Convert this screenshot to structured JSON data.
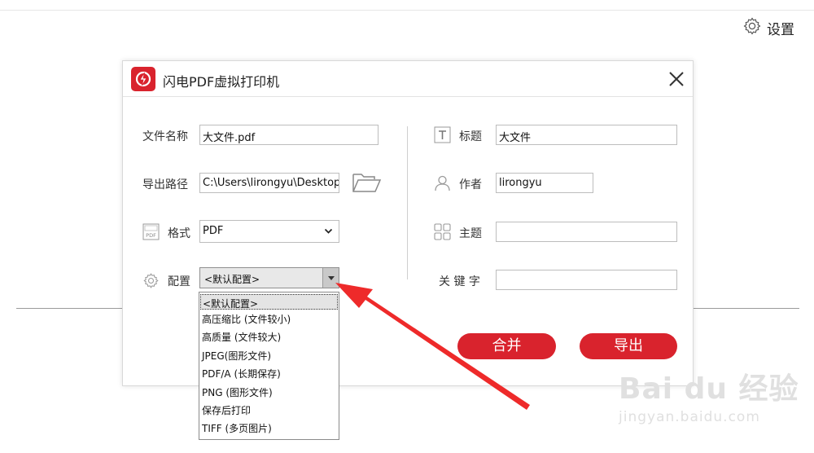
{
  "header": {
    "settings_label": "设置"
  },
  "dialog": {
    "title": "闪电PDF虚拟打印机",
    "left": {
      "filename": {
        "label": "文件名称",
        "value": "大文件.pdf"
      },
      "export_path": {
        "label": "导出路径",
        "value": "C:\\Users\\lirongyu\\Desktop"
      },
      "format": {
        "label": "格式",
        "value": "PDF"
      },
      "config": {
        "label": "配置",
        "value": "<默认配置>"
      }
    },
    "right": {
      "title_field": {
        "label": "标题",
        "value": "大文件"
      },
      "author_field": {
        "label": "作者",
        "value": "lirongyu"
      },
      "subject_field": {
        "label": "主题",
        "value": ""
      },
      "keyword_field": {
        "label": "关 键 字",
        "value": ""
      }
    },
    "buttons": {
      "merge": "合并",
      "export": "导出"
    }
  },
  "config_dropdown": {
    "options": [
      "<默认配置>",
      "高压缩比 (文件较小)",
      "高质量 (文件较大)",
      "JPEG(图形文件)",
      "PDF/A (长期保存)",
      "PNG (图形文件)",
      "保存后打印",
      "TIFF (多页图片)"
    ]
  },
  "watermark": {
    "main": "Bai du 经验",
    "sub": "jingyan.baidu.com"
  },
  "colors": {
    "accent": "#d9232d",
    "arrow": "#ee2a2a"
  }
}
